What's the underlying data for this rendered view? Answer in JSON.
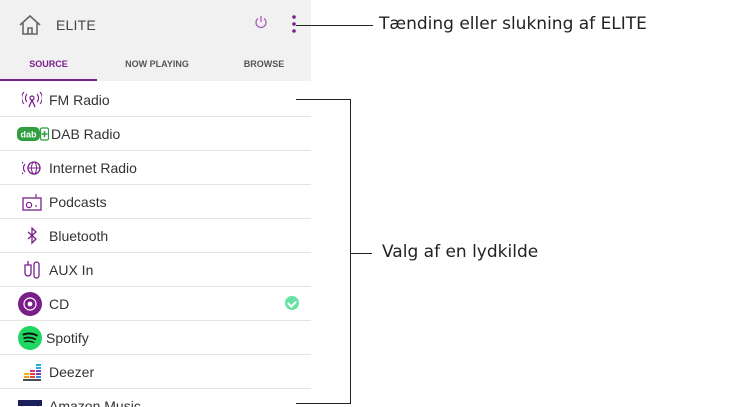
{
  "header": {
    "title": "ELITE",
    "home_icon": "home-icon",
    "power_icon": "power-icon",
    "menu_icon": "more-vertical-icon",
    "accent": "#7a1f8a"
  },
  "tabs": [
    {
      "label": "SOURCE",
      "active": true
    },
    {
      "label": "NOW PLAYING",
      "active": false
    },
    {
      "label": "BROWSE",
      "active": false
    }
  ],
  "sources": [
    {
      "label": "FM Radio",
      "icon": "fm-radio-icon"
    },
    {
      "label": "DAB Radio",
      "icon": "dab-icon"
    },
    {
      "label": "Internet Radio",
      "icon": "internet-radio-icon"
    },
    {
      "label": "Podcasts",
      "icon": "podcast-icon"
    },
    {
      "label": "Bluetooth",
      "icon": "bluetooth-icon"
    },
    {
      "label": "AUX In",
      "icon": "aux-icon"
    },
    {
      "label": "CD",
      "icon": "cd-icon",
      "selected": true
    },
    {
      "label": "Spotify",
      "icon": "spotify-icon"
    },
    {
      "label": "Deezer",
      "icon": "deezer-icon"
    },
    {
      "label": "Amazon Music",
      "icon": "amazon-music-icon"
    }
  ],
  "annotations": {
    "power": "Tænding eller slukning af ELITE",
    "source": "Valg af en lydkilde"
  }
}
